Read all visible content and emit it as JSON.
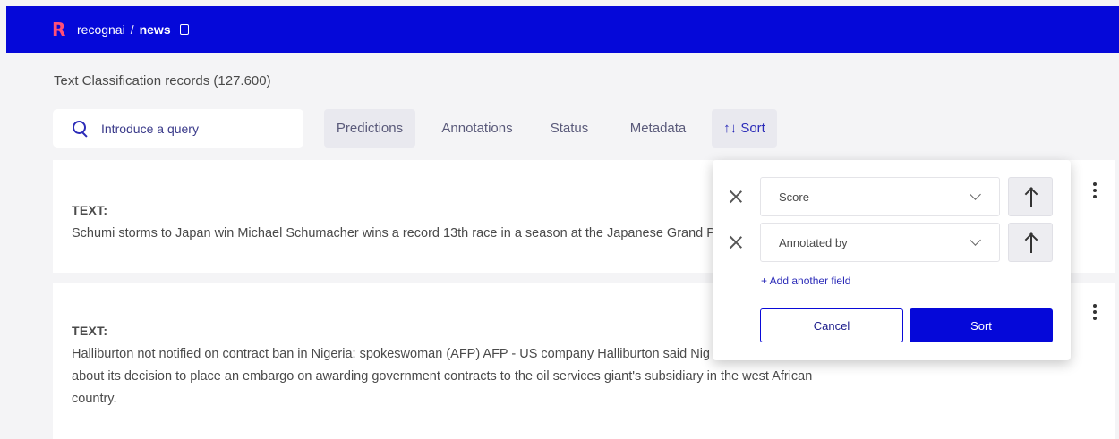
{
  "colors": {
    "topbar": "#0508d9",
    "brand": "#ff4f78",
    "accent": "#2b2bb8"
  },
  "header": {
    "logo": "R",
    "workspace": "recognai",
    "separator": "/",
    "dataset": "news",
    "copy_icon": "copy-icon"
  },
  "page": {
    "subtitle": "Text Classification records (127.600)"
  },
  "search": {
    "placeholder": "Introduce a query",
    "icon": "search-icon"
  },
  "filters": {
    "predictions": "Predictions",
    "annotations": "Annotations",
    "status": "Status",
    "metadata": "Metadata",
    "sort": "↑↓ Sort"
  },
  "records": [
    {
      "label": "TEXT:",
      "lines": [
        "Schumi storms to Japan win Michael Schumacher wins a record 13th race in a season at the Japanese Grand P"
      ]
    },
    {
      "label": "TEXT:",
      "lines": [
        "Halliburton not notified on contract ban in Nigeria: spokeswoman (AFP) AFP - US company Halliburton said Nig",
        "about its decision to place an embargo on awarding government contracts to the oil services giant's subsidiary in the west African",
        "country."
      ]
    }
  ],
  "sort_panel": {
    "fields": [
      {
        "value": "Score",
        "direction_icon": "arrow-up-icon"
      },
      {
        "value": "Annotated by",
        "direction_icon": "arrow-up-icon"
      }
    ],
    "add_field": "+ Add another field",
    "cancel": "Cancel",
    "sort": "Sort"
  }
}
